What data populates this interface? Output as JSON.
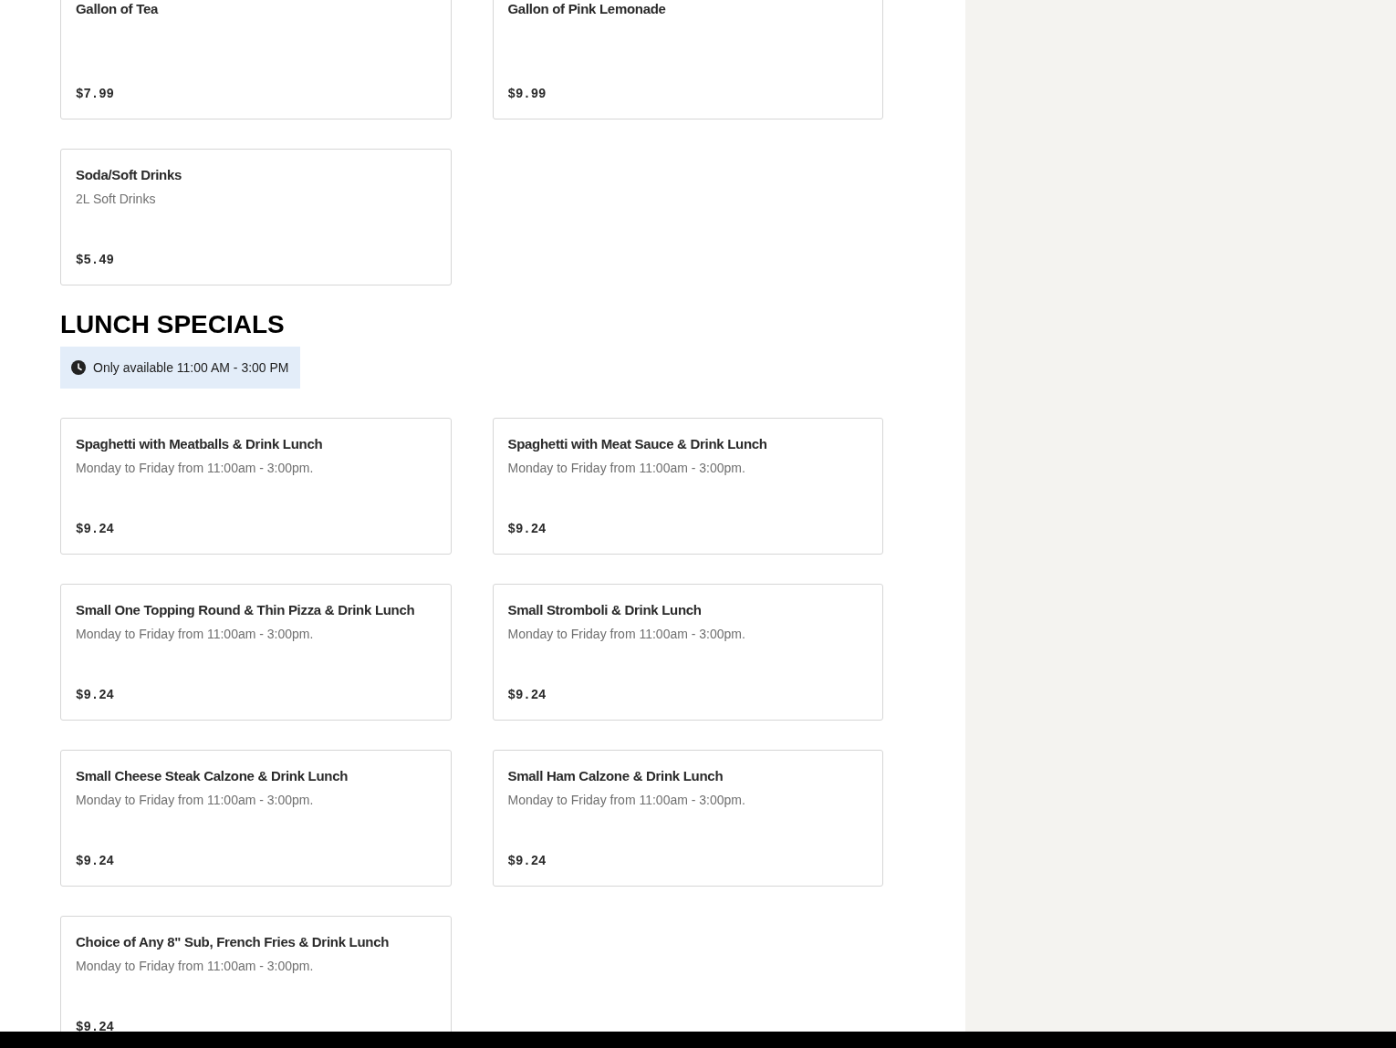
{
  "sections": [
    {
      "items": [
        {
          "name": "Gallon of Tea",
          "price": "$7.99"
        },
        {
          "name": "Gallon of Pink Lemonade",
          "price": "$9.99"
        },
        {
          "name": "Soda/Soft Drinks",
          "description": "2L Soft Drinks",
          "price": "$5.49"
        }
      ]
    },
    {
      "title": "LUNCH SPECIALS",
      "availability": "Only available 11:00 AM - 3:00 PM",
      "items": [
        {
          "name": "Spaghetti with Meatballs & Drink Lunch",
          "description": "Monday to Friday from 11:00am - 3:00pm.",
          "price": "$9.24"
        },
        {
          "name": "Spaghetti with Meat Sauce & Drink Lunch",
          "description": "Monday to Friday from 11:00am - 3:00pm.",
          "price": "$9.24"
        },
        {
          "name": "Small One Topping Round & Thin Pizza & Drink Lunch",
          "description": "Monday to Friday from 11:00am - 3:00pm.",
          "price": "$9.24"
        },
        {
          "name": "Small Stromboli & Drink Lunch",
          "description": "Monday to Friday from 11:00am - 3:00pm.",
          "price": "$9.24"
        },
        {
          "name": "Small Cheese Steak Calzone & Drink Lunch",
          "description": "Monday to Friday from 11:00am - 3:00pm.",
          "price": "$9.24"
        },
        {
          "name": "Small Ham Calzone & Drink Lunch",
          "description": "Monday to Friday from 11:00am - 3:00pm.",
          "price": "$9.24"
        },
        {
          "name": "Choice of Any 8\" Sub, French Fries & Drink Lunch",
          "description": "Monday to Friday from 11:00am - 3:00pm.",
          "price": "$9.24"
        }
      ]
    }
  ]
}
